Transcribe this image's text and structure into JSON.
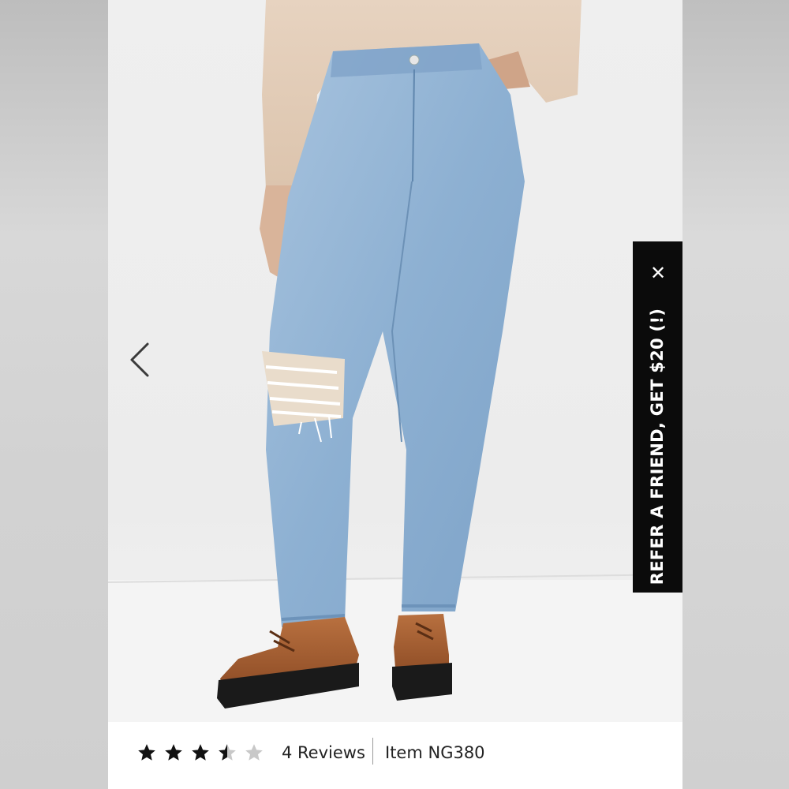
{
  "gallery": {
    "prev_icon": "chevron-left-icon",
    "image_alt": "Model wearing light-wash high-rise straight jeans with ripped knee and brown lace-up boots"
  },
  "promo_tab": {
    "text": "REFER A FRIEND, GET $20 (!)",
    "close_symbol": "✕",
    "background": "#0b0b0b",
    "text_color": "#ffffff"
  },
  "product_info": {
    "rating": 3.5,
    "rating_max": 5,
    "reviews_label": "4 Reviews",
    "item_label": "Item NG380"
  },
  "colors": {
    "star_filled": "#111111",
    "star_empty": "#c8c8c8",
    "denim": "#8fb0d0",
    "boot": "#9a5630"
  }
}
